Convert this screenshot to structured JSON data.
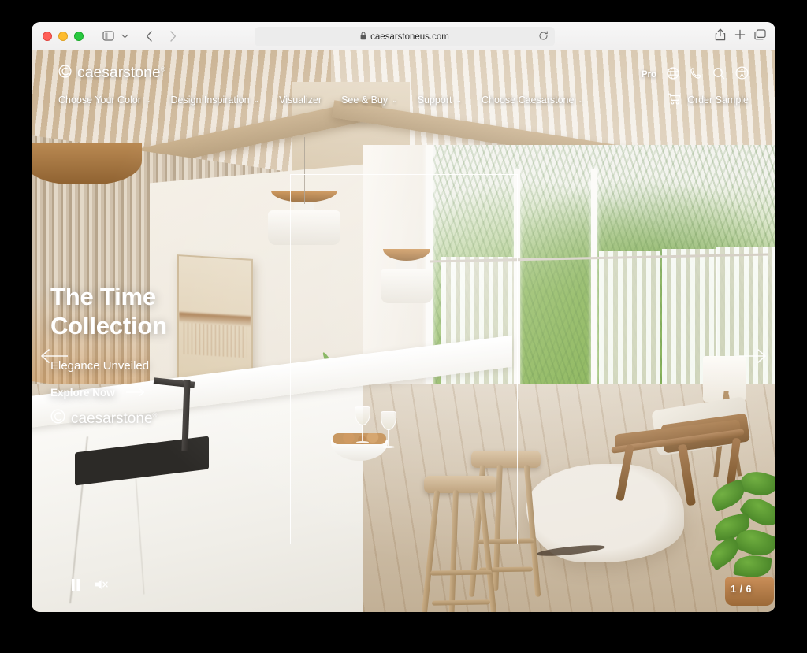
{
  "browser": {
    "url": "caesarstoneus.com",
    "lock_icon": "lock-icon",
    "reload_icon": "reload-icon",
    "sidebar_icon": "sidebar-toggle-icon",
    "chevron_icon": "chevron-down-icon",
    "back_icon": "back-arrow-icon",
    "forward_icon": "forward-arrow-icon",
    "share_icon": "share-icon",
    "newtab_icon": "plus-icon",
    "tabs_icon": "tab-overview-icon",
    "traffic": {
      "close": "close-button",
      "minimize": "minimize-button",
      "zoom": "zoom-button"
    }
  },
  "site": {
    "brand": "caesarstone",
    "brand_registered": "®",
    "nav": [
      {
        "label": "Choose Your Color",
        "has_caret": true
      },
      {
        "label": "Design Inspiration",
        "has_caret": true
      },
      {
        "label": "Visualizer",
        "has_caret": false
      },
      {
        "label": "See & Buy",
        "has_caret": true
      },
      {
        "label": "Support",
        "has_caret": true
      },
      {
        "label": "Choose Caesarstone",
        "has_caret": true
      }
    ],
    "utility": {
      "pro_label": "Pro",
      "globe_icon": "globe-icon",
      "phone_icon": "phone-icon",
      "search_icon": "search-icon",
      "accessibility_icon": "accessibility-icon"
    },
    "order_sample": {
      "label": "Order Sample",
      "icon": "shopping-cart-icon"
    }
  },
  "hero": {
    "title_line1": "The Time",
    "title_line2": "Collection",
    "subtitle": "Elegance Unveiled",
    "cta_label": "Explore Now",
    "cta_icon": "arrow-right-icon",
    "watermark_brand": "caesarstone",
    "watermark_registered": "®"
  },
  "carousel": {
    "prev_icon": "arrow-left-icon",
    "next_icon": "arrow-right-icon",
    "counter": "1 / 6",
    "current_slide": 1,
    "total_slides": 6,
    "pause_icon": "pause-icon",
    "mute_icon": "speaker-muted-icon"
  },
  "colors": {
    "overlay_text": "#ffffff",
    "frame_border": "#ffffff",
    "toolbar_bg": "#f4f3f3",
    "page_bg": "#000000"
  }
}
